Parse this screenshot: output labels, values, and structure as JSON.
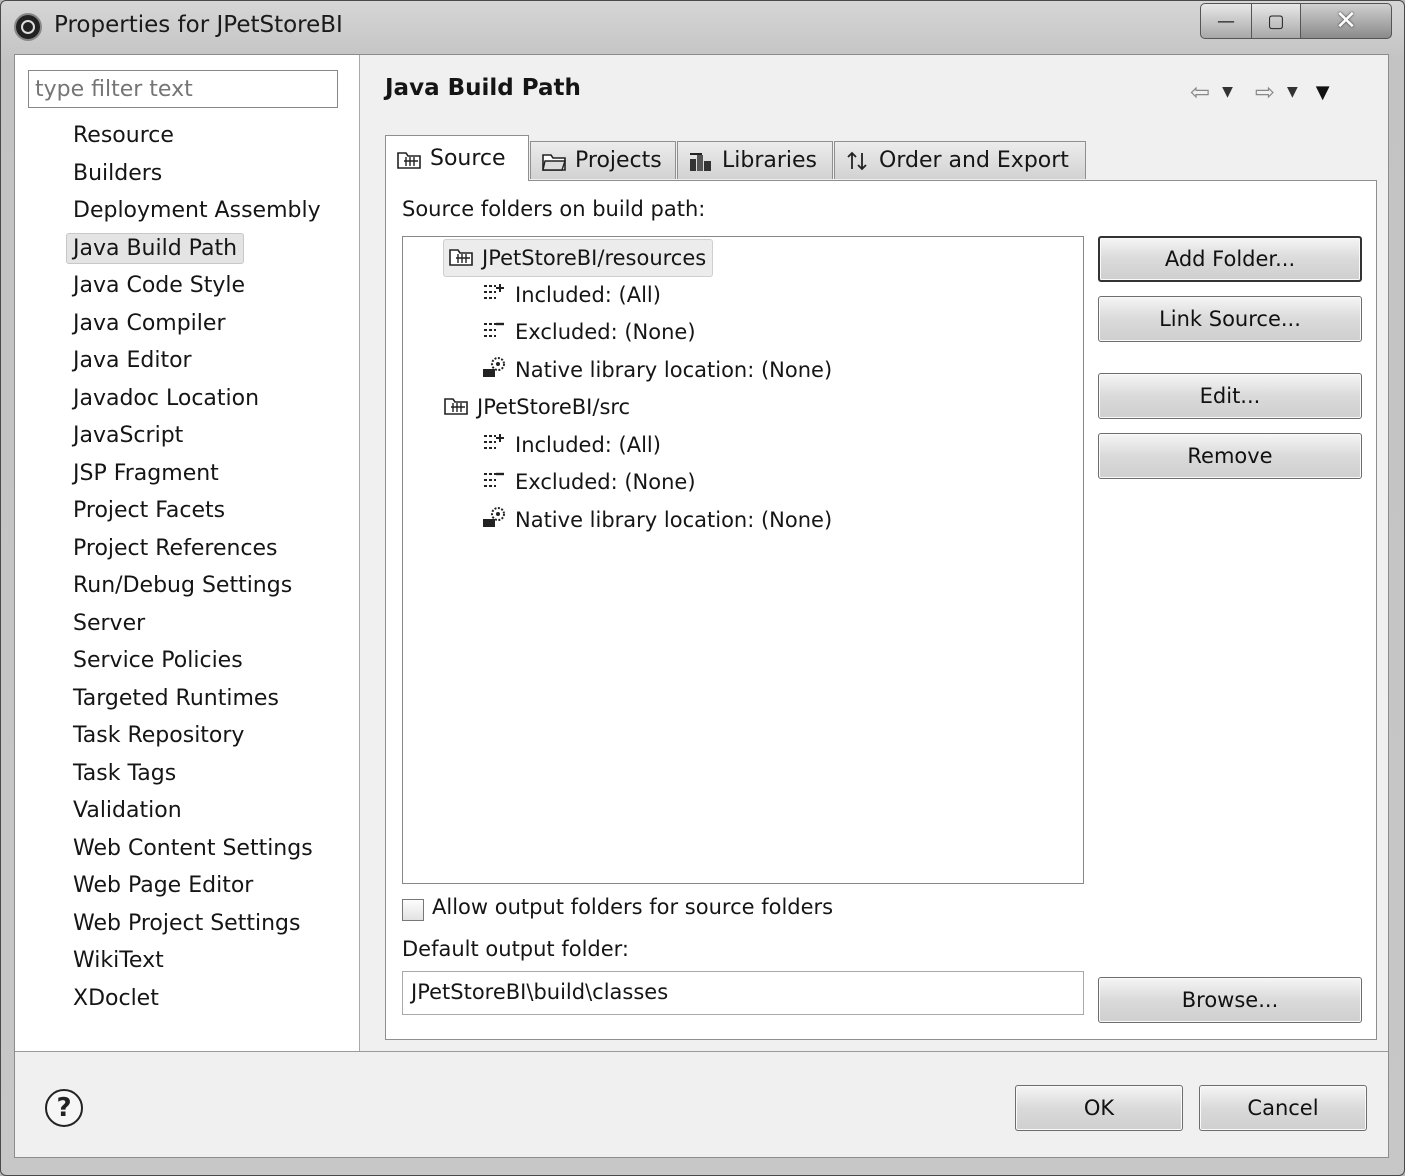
{
  "window": {
    "title": "Properties for JPetStoreBI",
    "minimize_glyph": "—",
    "maximize_glyph": "▢",
    "close_glyph": "✕"
  },
  "filter": {
    "placeholder": "type filter text",
    "value": ""
  },
  "nav": {
    "items": [
      "Resource",
      "Builders",
      "Deployment Assembly",
      "Java Build Path",
      "Java Code Style",
      "Java Compiler",
      "Java Editor",
      "Javadoc Location",
      "JavaScript",
      "JSP Fragment",
      "Project Facets",
      "Project References",
      "Run/Debug Settings",
      "Server",
      "Service Policies",
      "Targeted Runtimes",
      "Task Repository",
      "Task Tags",
      "Validation",
      "Web Content Settings",
      "Web Page Editor",
      "Web Project Settings",
      "WikiText",
      "XDoclet"
    ],
    "selected": "Java Build Path"
  },
  "page": {
    "title": "Java Build Path"
  },
  "tabs": [
    {
      "label": "Source",
      "icon": "source-folder-icon",
      "active": true
    },
    {
      "label": "Projects",
      "icon": "project-folder-icon",
      "active": false
    },
    {
      "label": "Libraries",
      "icon": "libraries-icon",
      "active": false
    },
    {
      "label": "Order and Export",
      "icon": "order-export-icon",
      "active": false
    }
  ],
  "source": {
    "heading": "Source folders on build path:",
    "tree": [
      {
        "label": "JPetStoreBI/resources",
        "selected": true,
        "children": [
          "Included: (All)",
          "Excluded: (None)",
          "Native library location: (None)"
        ]
      },
      {
        "label": "JPetStoreBI/src",
        "selected": false,
        "children": [
          "Included: (All)",
          "Excluded: (None)",
          "Native library location: (None)"
        ]
      }
    ],
    "buttons": {
      "add_folder": "Add Folder...",
      "link_source": "Link Source...",
      "edit": "Edit...",
      "remove": "Remove",
      "browse": "Browse..."
    },
    "allow_output_label": "Allow output folders for source folders",
    "allow_output_checked": false,
    "default_output_label": "Default output folder:",
    "default_output_value": "JPetStoreBI\\build\\classes"
  },
  "footer": {
    "ok": "OK",
    "cancel": "Cancel"
  },
  "colors": {
    "window_bg": "#f0f0f0",
    "selection": "#e4e4e4"
  }
}
